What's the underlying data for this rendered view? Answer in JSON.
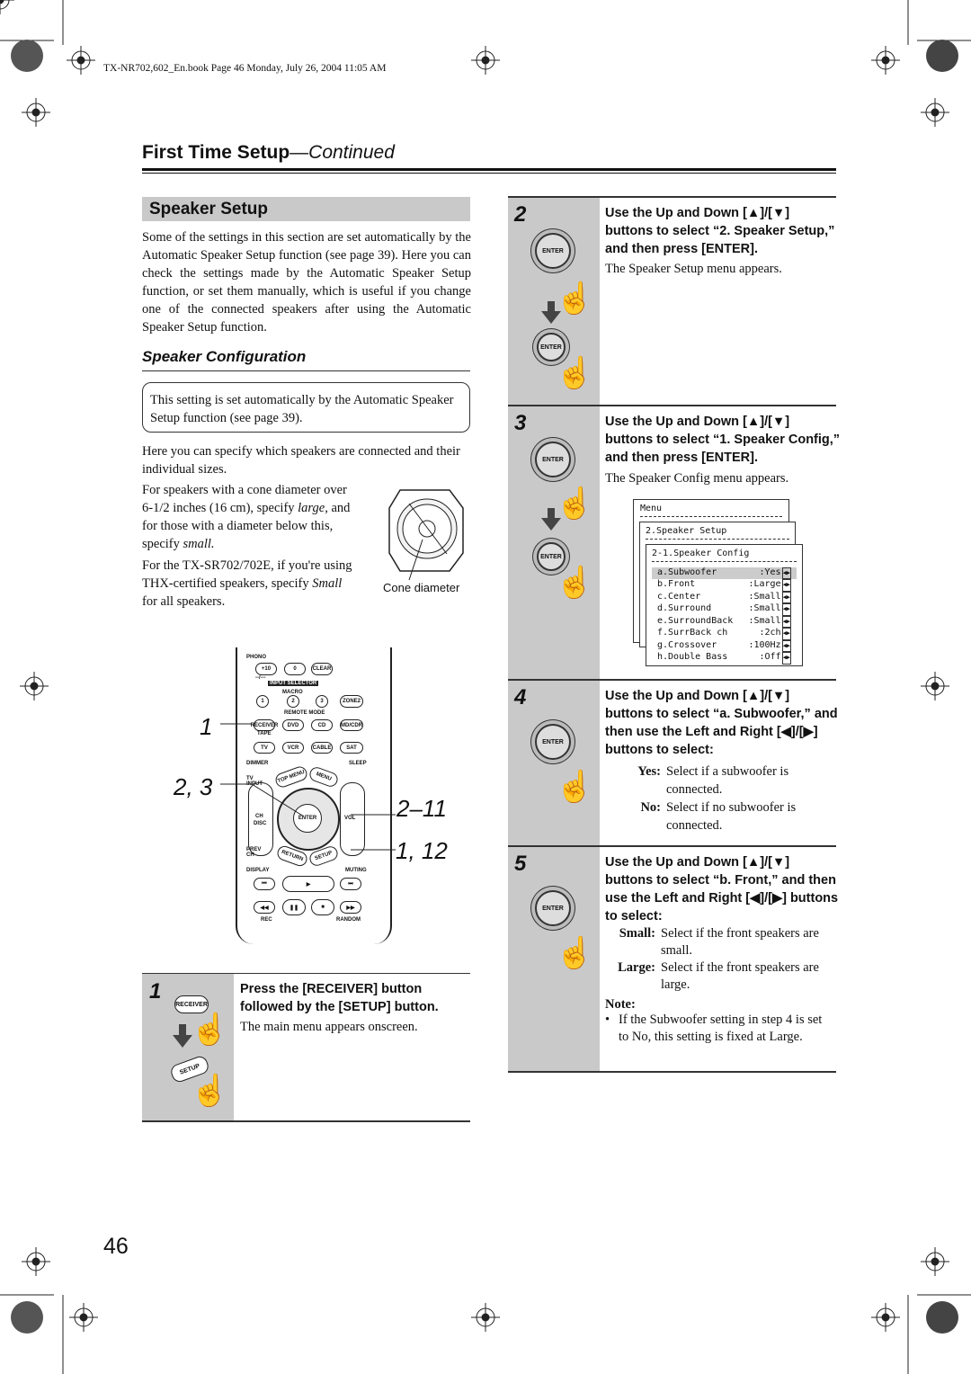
{
  "header": {
    "book_info": "TX-NR702,602_En.book Page 46 Monday, July 26, 2004 11:05 AM",
    "title_main": "First Time Setup",
    "title_cont": "—Continued"
  },
  "left": {
    "section_title": "Speaker Setup",
    "intro": "Some of the settings in this section are set automatically by the Automatic Speaker Setup function (see page 39). Here you can check the settings made by the Automatic Speaker Setup function, or set them manually, which is useful if you change one of the connected speakers after using the Automatic Speaker Setup function.",
    "subsection_title": "Speaker Configuration",
    "note_box": "This setting is set automatically by the Automatic Speaker Setup function (see page 39).",
    "para1": "Here you can specify which speakers are connected and their individual sizes.",
    "para2_a": "For speakers with a cone diameter over 6-1/2 inches (16 cm), specify ",
    "para2_large": "large,",
    "para2_b": " and for those with a diameter below this, specify ",
    "para2_small": "small.",
    "para3_a": "For the TX-SR702/702E, if you're using THX-certified speakers, specify ",
    "para3_small": "Small",
    "para3_b": " for all speakers.",
    "cone_label": "Cone diameter",
    "callouts": [
      "1",
      "2, 3",
      "2–11",
      "1, 12"
    ],
    "remote": {
      "phono": "PHONO",
      "plus10": "+10",
      "zero": "0",
      "clear": "CLEAR",
      "dash": "--/---",
      "input_selector": "INPUT SELECTOR",
      "macro": "MACRO",
      "m1": "1",
      "m2": "2",
      "m3": "3",
      "zone2": "ZONE2",
      "remote_mode": "REMOTE MODE",
      "receiver": "RECEIVER",
      "dvd": "DVD",
      "cd": "CD",
      "mdcdr": "MD/CDR",
      "tape": "TAPE",
      "tv": "TV",
      "vcr": "VCR",
      "cable": "CABLE",
      "sat": "SAT",
      "dimmer": "DIMMER",
      "sleep": "SLEEP",
      "tvinput": "TV INPUT",
      "topmenu": "TOP MENU",
      "menu": "MENU",
      "ch": "CH",
      "disc": "DISC",
      "enter": "ENTER",
      "vol": "VOL",
      "prevch": "PREV CH",
      "return": "RETURN",
      "setup": "SETUP",
      "display": "DISPLAY",
      "muting": "MUTING",
      "rec": "REC",
      "random": "RANDOM"
    },
    "step1": {
      "num": "1",
      "title": "Press the [RECEIVER] button followed by the [SETUP] button.",
      "desc": "The main menu appears onscreen.",
      "btn_receiver": "RECEIVER",
      "btn_setup": "SETUP"
    }
  },
  "right": {
    "enter_label": "ENTER",
    "step2": {
      "num": "2",
      "title": "Use the Up and Down [▲]/[▼] buttons to select “2. Speaker Setup,” and then press [ENTER].",
      "desc": "The Speaker Setup menu appears."
    },
    "step3": {
      "num": "3",
      "title": "Use the Up and Down [▲]/[▼] buttons to select “1. Speaker Config,” and then press [ENTER].",
      "desc": "The Speaker Config menu appears.",
      "osd": {
        "menu": "Menu",
        "setup": "2.Speaker Setup",
        "config": "2-1.Speaker Config",
        "rows": [
          {
            "label": "a.Subwoofer",
            "value": ":Yes",
            "selected": true
          },
          {
            "label": "b.Front",
            "value": ":Large"
          },
          {
            "label": "c.Center",
            "value": ":Small"
          },
          {
            "label": "d.Surround",
            "value": ":Small"
          },
          {
            "label": "e.SurroundBack",
            "value": ":Small"
          },
          {
            "label": "f.SurrBack ch",
            "value": ":2ch"
          },
          {
            "label": "g.Crossover",
            "value": ":100Hz"
          },
          {
            "label": "h.Double Bass",
            "value": ":Off"
          }
        ]
      }
    },
    "step4": {
      "num": "4",
      "title": "Use the Up and Down [▲]/[▼] buttons to select “a. Subwoofer,” and then use the Left and Right [◀]/[▶] buttons to select:",
      "terms": [
        {
          "term": "Yes:",
          "def": "Select if a subwoofer is connected."
        },
        {
          "term": "No:",
          "def": "Select if no subwoofer is connected."
        }
      ]
    },
    "step5": {
      "num": "5",
      "title": "Use the Up and Down [▲]/[▼] buttons to select “b. Front,” and then use the Left and Right [◀]/[▶] buttons to select:",
      "terms": [
        {
          "term": "Small:",
          "def": "Select if the front speakers are small."
        },
        {
          "term": "Large:",
          "def": "Select if the front speakers are large."
        }
      ],
      "note_title": "Note:",
      "note": "If the Subwoofer setting in step 4 is set to No, this setting is fixed at Large."
    }
  },
  "footer": {
    "page_number": "46"
  }
}
